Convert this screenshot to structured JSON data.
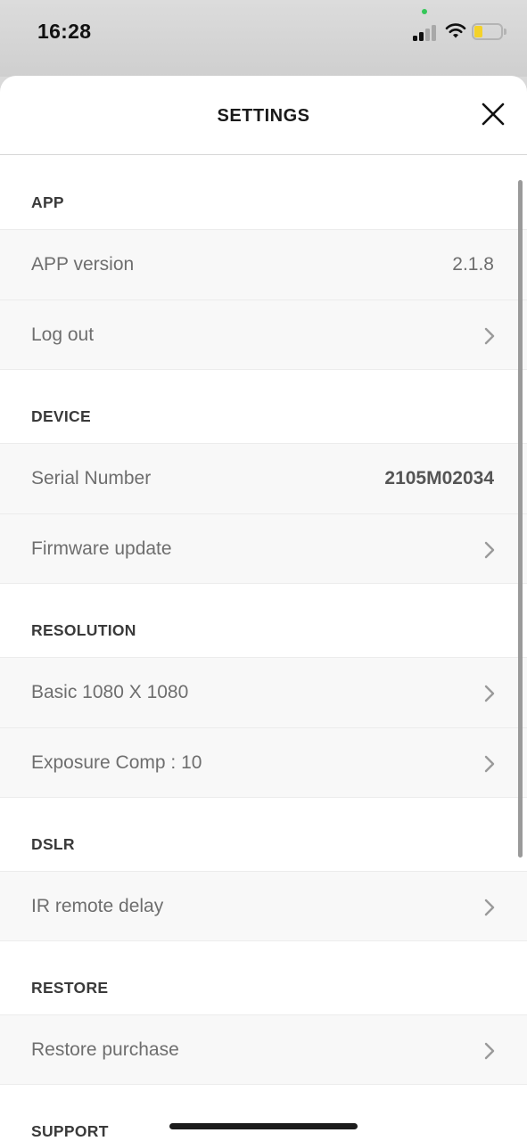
{
  "status_bar": {
    "time": "16:28",
    "icons": [
      "cellular-signal-icon",
      "wifi-icon",
      "battery-icon"
    ],
    "battery_color": "#f4d229"
  },
  "header": {
    "title": "SETTINGS",
    "close_icon": "close-icon"
  },
  "sections": {
    "app": {
      "title": "APP",
      "rows": [
        {
          "label": "APP version",
          "value": "2.1.8"
        },
        {
          "label": "Log out"
        }
      ]
    },
    "device": {
      "title": "DEVICE",
      "rows": [
        {
          "label": "Serial Number",
          "value": "2105M02034"
        },
        {
          "label": "Firmware update"
        }
      ]
    },
    "resolution": {
      "title": "RESOLUTION",
      "rows": [
        {
          "label": "Basic 1080 X 1080"
        },
        {
          "label": "Exposure Comp : 10"
        }
      ]
    },
    "dslr": {
      "title": "DSLR",
      "rows": [
        {
          "label": "IR remote delay"
        }
      ]
    },
    "restore": {
      "title": "RESTORE",
      "rows": [
        {
          "label": "Restore purchase"
        }
      ]
    },
    "support": {
      "title": "SUPPORT"
    }
  }
}
